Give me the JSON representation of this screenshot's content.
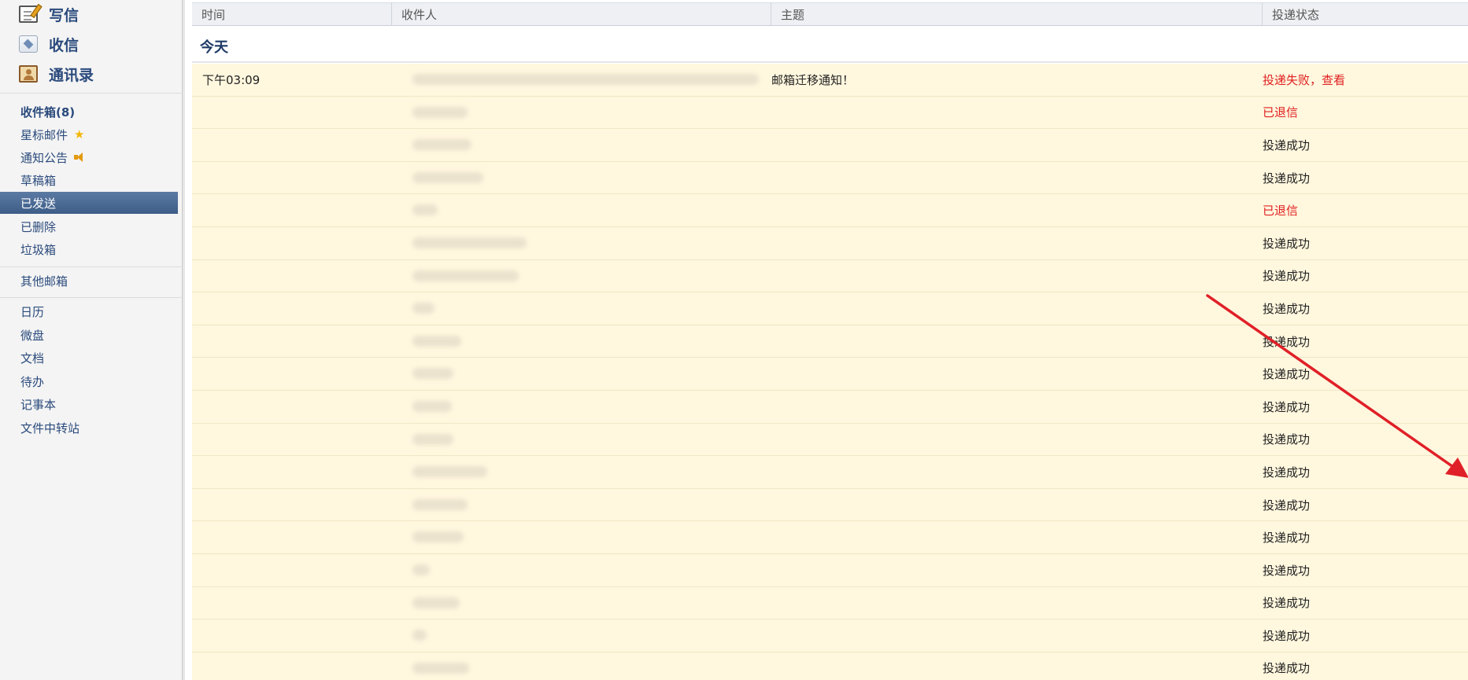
{
  "sidebar": {
    "actions": [
      {
        "label": "写信",
        "icon": "compose-icon"
      },
      {
        "label": "收信",
        "icon": "inbox-icon"
      },
      {
        "label": "通讯录",
        "icon": "contacts-icon"
      }
    ],
    "folders": [
      {
        "label": "收件箱(8)"
      },
      {
        "label": "星标邮件",
        "icon": "star-icon"
      },
      {
        "label": "通知公告",
        "icon": "speaker-icon"
      },
      {
        "label": "草稿箱"
      },
      {
        "label": "已发送",
        "active": true
      },
      {
        "label": "已删除"
      },
      {
        "label": "垃圾箱"
      }
    ],
    "other": "其他邮箱",
    "apps": [
      "日历",
      "微盘",
      "文档",
      "待办",
      "记事本",
      "文件中转站"
    ]
  },
  "table": {
    "headers": [
      "时间",
      "收件人",
      "主题",
      "投递状态"
    ],
    "group_title": "今天",
    "rows": [
      {
        "time": "下午03:09",
        "subject": "邮箱迁移通知！",
        "status": "投递失败，查看",
        "status_type": "bad"
      },
      {
        "time": "",
        "subject": "",
        "status": "已退信",
        "status_type": "bad"
      },
      {
        "time": "",
        "subject": "",
        "status": "投递成功",
        "status_type": "ok"
      },
      {
        "time": "",
        "subject": "",
        "status": "投递成功",
        "status_type": "ok"
      },
      {
        "time": "",
        "subject": "",
        "status": "已退信",
        "status_type": "bad"
      },
      {
        "time": "",
        "subject": "",
        "status": "投递成功",
        "status_type": "ok"
      },
      {
        "time": "",
        "subject": "",
        "status": "投递成功",
        "status_type": "ok"
      },
      {
        "time": "",
        "subject": "",
        "status": "投递成功",
        "status_type": "ok"
      },
      {
        "time": "",
        "subject": "",
        "status": "投递成功",
        "status_type": "ok"
      },
      {
        "time": "",
        "subject": "",
        "status": "投递成功",
        "status_type": "ok"
      },
      {
        "time": "",
        "subject": "",
        "status": "投递成功",
        "status_type": "ok"
      },
      {
        "time": "",
        "subject": "",
        "status": "投递成功",
        "status_type": "ok"
      },
      {
        "time": "",
        "subject": "",
        "status": "投递成功",
        "status_type": "ok"
      },
      {
        "time": "",
        "subject": "",
        "status": "投递成功",
        "status_type": "ok"
      },
      {
        "time": "",
        "subject": "",
        "status": "投递成功",
        "status_type": "ok"
      },
      {
        "time": "",
        "subject": "",
        "status": "投递成功",
        "status_type": "ok"
      },
      {
        "time": "",
        "subject": "",
        "status": "投递成功",
        "status_type": "ok"
      },
      {
        "time": "",
        "subject": "",
        "status": "投递成功",
        "status_type": "ok"
      },
      {
        "time": "",
        "subject": "",
        "status": "投递成功",
        "status_type": "ok"
      }
    ]
  },
  "colors": {
    "status_ok": "#222222",
    "status_bad": "#e02020",
    "row_bg": "#fff7de",
    "active_nav": "#3d5d88",
    "annotation_arrow": "#e02028"
  }
}
